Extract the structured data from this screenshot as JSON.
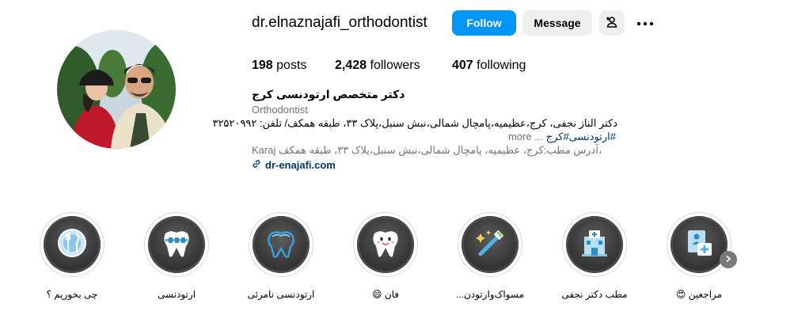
{
  "profile": {
    "username": "dr.elnaznajafi_orthodontist",
    "follow_label": "Follow",
    "message_label": "Message"
  },
  "stats": {
    "posts_count": "198",
    "posts_label": "posts",
    "followers_count": "2,428",
    "followers_label": "followers",
    "following_count": "407",
    "following_label": "following"
  },
  "bio": {
    "name": "دکتر متخصص ارتودنسی کرج",
    "category": "Orthodontist",
    "line1": "دکتر الناز نجفی، کرج،عظیمیه،پامچال شمالی،نبش سنبل،پلاک ۳۳، طبقه همکف/ تلفن: ۳۲۵۲۰۹۹۲",
    "line2_hashtags": "#ارتودنسی#کرج",
    "line2_more": "... more",
    "address": "آدرس مطب:کرج، عظیمیه، پامچال شمالی،نبش سنبل،پلاک ۳۳، طبقه همکف،",
    "address_city": "Karaj",
    "link": "dr-enajafi.com"
  },
  "highlights": [
    {
      "label": "چی بخوریم ؟",
      "icon": "plate-fork-knife-icon"
    },
    {
      "label": "ارتودنسی",
      "icon": "tooth-braces-icon"
    },
    {
      "label": "ارتودنسی نامرئی",
      "icon": "clear-aligner-tooth-icon"
    },
    {
      "label": "فان 😄",
      "icon": "smiling-tooth-icon"
    },
    {
      "label": "مسواک‌وارتودن...",
      "icon": "toothbrush-icon"
    },
    {
      "label": "مطب دکتر نجفی",
      "icon": "clinic-building-icon"
    },
    {
      "label": "مراجعین 😍",
      "icon": "patient-chart-icon"
    }
  ],
  "colors": {
    "follow_button": "#0095f6",
    "secondary_button": "#efefef",
    "link": "#00376b",
    "muted_text": "#737373"
  }
}
